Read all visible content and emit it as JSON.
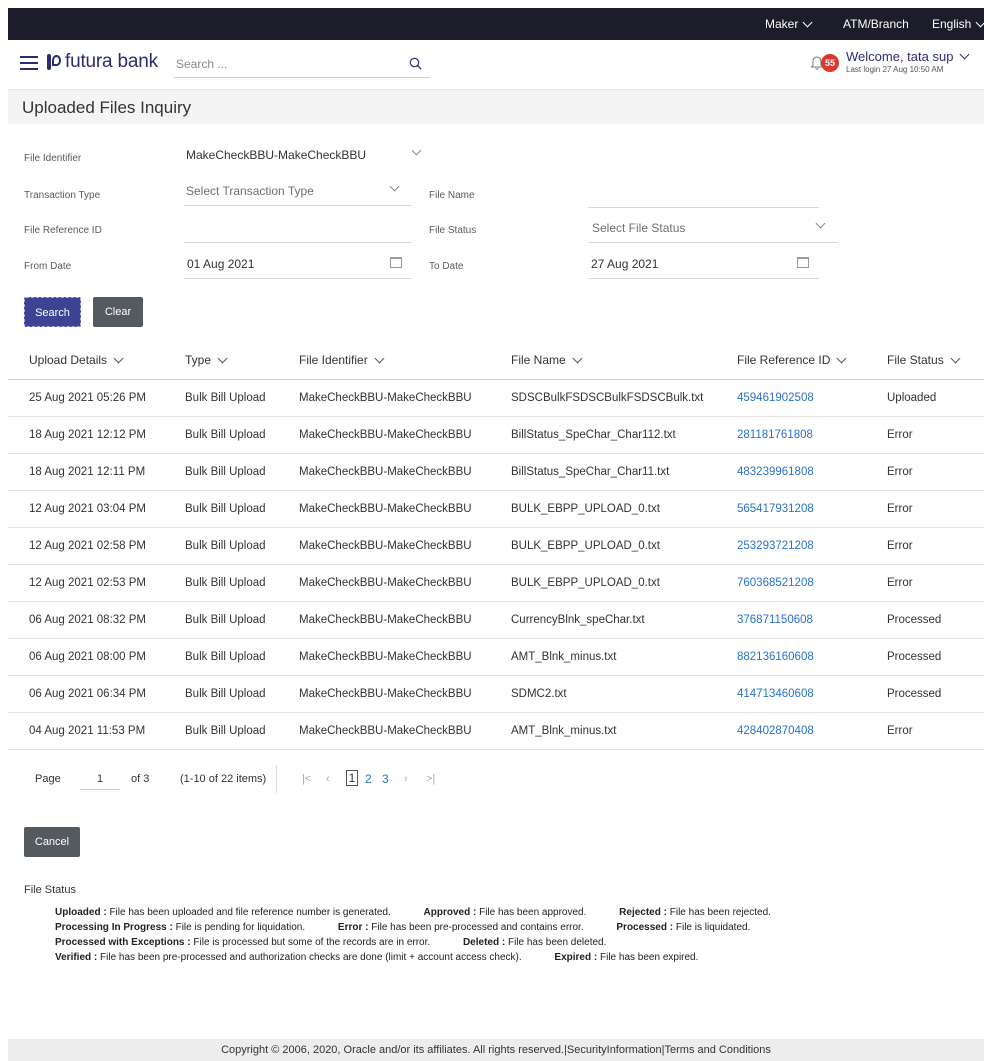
{
  "topbar": {
    "role": "Maker",
    "branch": "ATM/Branch",
    "language": "English"
  },
  "header": {
    "logo_text": "futura bank",
    "search_placeholder": "Search ...",
    "notification_count": "55",
    "welcome": "Welcome, tata sup",
    "last_login": "Last login 27 Aug 10:50 AM"
  },
  "page_title": "Uploaded Files Inquiry",
  "form": {
    "file_identifier_label": "File Identifier",
    "file_identifier_value": "MakeCheckBBU-MakeCheckBBU",
    "transaction_type_label": "Transaction Type",
    "transaction_type_placeholder": "Select Transaction Type",
    "file_name_label": "File Name",
    "file_name_value": "",
    "file_reference_label": "File Reference ID",
    "file_reference_value": "",
    "file_status_label": "File Status",
    "file_status_placeholder": "Select File Status",
    "from_date_label": "From Date",
    "from_date_value": "01 Aug 2021",
    "to_date_label": "To Date",
    "to_date_value": "27 Aug 2021",
    "search_button": "Search",
    "clear_button": "Clear"
  },
  "table": {
    "columns": [
      "Upload Details",
      "Type",
      "File Identifier",
      "File Name",
      "File Reference ID",
      "File Status"
    ],
    "rows": [
      [
        "25 Aug 2021 05:26 PM",
        "Bulk Bill Upload",
        "MakeCheckBBU-MakeCheckBBU",
        "SDSCBulkFSDSCBulkFSDSCBulk.txt",
        "459461902508",
        "Uploaded"
      ],
      [
        "18 Aug 2021 12:12 PM",
        "Bulk Bill Upload",
        "MakeCheckBBU-MakeCheckBBU",
        "BillStatus_SpeChar_Char112.txt",
        "281181761808",
        "Error"
      ],
      [
        "18 Aug 2021 12:11 PM",
        "Bulk Bill Upload",
        "MakeCheckBBU-MakeCheckBBU",
        "BillStatus_SpeChar_Char11.txt",
        "483239961808",
        "Error"
      ],
      [
        "12 Aug 2021 03:04 PM",
        "Bulk Bill Upload",
        "MakeCheckBBU-MakeCheckBBU",
        "BULK_EBPP_UPLOAD_0.txt",
        "565417931208",
        "Error"
      ],
      [
        "12 Aug 2021 02:58 PM",
        "Bulk Bill Upload",
        "MakeCheckBBU-MakeCheckBBU",
        "BULK_EBPP_UPLOAD_0.txt",
        "253293721208",
        "Error"
      ],
      [
        "12 Aug 2021 02:53 PM",
        "Bulk Bill Upload",
        "MakeCheckBBU-MakeCheckBBU",
        "BULK_EBPP_UPLOAD_0.txt",
        "760368521208",
        "Error"
      ],
      [
        "06 Aug 2021 08:32 PM",
        "Bulk Bill Upload",
        "MakeCheckBBU-MakeCheckBBU",
        "CurrencyBlnk_speChar.txt",
        "376871150608",
        "Processed"
      ],
      [
        "06 Aug 2021 08:00 PM",
        "Bulk Bill Upload",
        "MakeCheckBBU-MakeCheckBBU",
        "AMT_Blnk_minus.txt",
        "882136160608",
        "Processed"
      ],
      [
        "06 Aug 2021 06:34 PM",
        "Bulk Bill Upload",
        "MakeCheckBBU-MakeCheckBBU",
        "SDMC2.txt",
        "414713460608",
        "Processed"
      ],
      [
        "04 Aug 2021 11:53 PM",
        "Bulk Bill Upload",
        "MakeCheckBBU-MakeCheckBBU",
        "AMT_Blnk_minus.txt",
        "428402870408",
        "Error"
      ]
    ]
  },
  "pagination": {
    "page_label": "Page",
    "current_page": "1",
    "of_label": "of 3",
    "items_label": "(1-10 of 22 items)",
    "pages": [
      "1",
      "2",
      "3"
    ]
  },
  "cancel_button": "Cancel",
  "legend": {
    "title": "File Status",
    "lines": [
      [
        {
          "term": "Uploaded :",
          "desc": " File has been uploaded and file reference number is generated."
        },
        {
          "term": "Approved :",
          "desc": " File has been approved."
        },
        {
          "term": "Rejected :",
          "desc": " File has been rejected."
        }
      ],
      [
        {
          "term": "Processing In Progress :",
          "desc": " File is pending for liquidation."
        },
        {
          "term": "Error :",
          "desc": " File has been pre-processed and contains error."
        },
        {
          "term": "Processed :",
          "desc": " File is liquidated."
        }
      ],
      [
        {
          "term": "Processed with Exceptions :",
          "desc": " File is processed but some of the records are in error."
        },
        {
          "term": "Deleted :",
          "desc": " File has been deleted."
        }
      ],
      [
        {
          "term": "Verified :",
          "desc": " File has been pre-processed and authorization checks are done (limit + account access check)."
        },
        {
          "term": "Expired :",
          "desc": " File has been expired."
        }
      ]
    ]
  },
  "footer": "Copyright © 2006, 2020, Oracle and/or its affiliates. All rights reserved.|SecurityInformation|Terms and Conditions",
  "colors": {
    "brand": "#2b2d6e",
    "link": "#2a72c9",
    "topbar": "#1c1c2a",
    "badge": "#d93a2b",
    "primary_button": "#3d4392",
    "secondary_button": "#555a5f"
  },
  "icons": [
    "hamburger-menu-icon",
    "futura-logo-icon",
    "search-icon",
    "bell-icon",
    "chevron-down-icon",
    "calendar-icon",
    "first-page-icon",
    "prev-page-icon",
    "next-page-icon",
    "last-page-icon"
  ]
}
